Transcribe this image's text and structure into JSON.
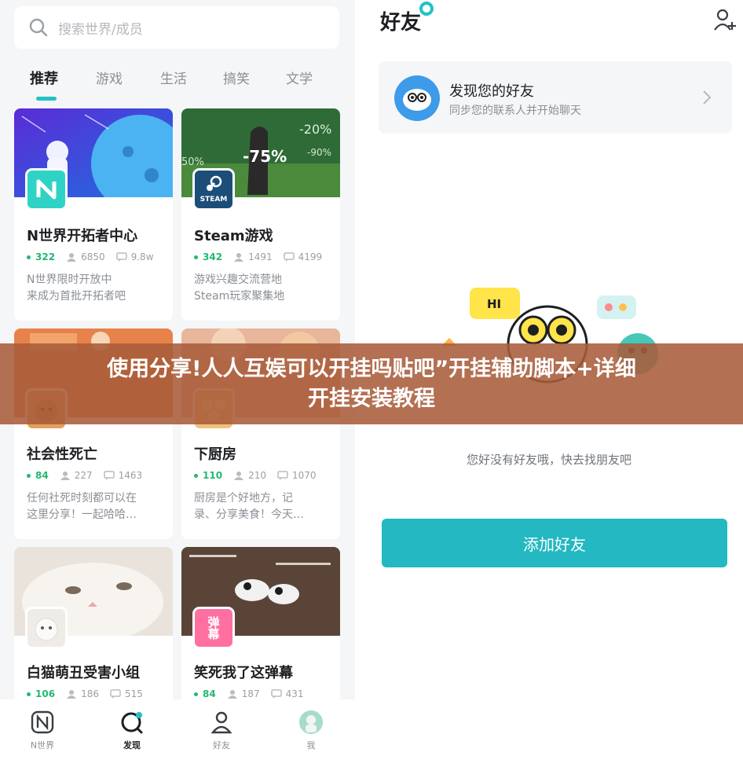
{
  "left": {
    "search": {
      "placeholder": "搜索世界/成员"
    },
    "tabs": [
      {
        "label": "推荐",
        "active": true
      },
      {
        "label": "游戏"
      },
      {
        "label": "生活"
      },
      {
        "label": "搞笑"
      },
      {
        "label": "文学"
      }
    ],
    "cards": [
      {
        "title": "N世界开拓者中心",
        "online": "322",
        "members": "6850",
        "posts": "9.8w",
        "desc": "N世界限时开放中\n来成为首批开拓者吧",
        "avatar": "n-world-logo"
      },
      {
        "title": "Steam游戏",
        "online": "342",
        "members": "1491",
        "posts": "4199",
        "desc": "游戏兴趣交流营地\nSteam玩家聚集地",
        "avatar": "steam-logo",
        "avatar_text": "STEAM"
      },
      {
        "title": "社会性死亡",
        "online": "84",
        "members": "227",
        "posts": "1463",
        "desc": "任何社死时刻都可以在\n这里分享！一起哈哈…"
      },
      {
        "title": "下厨房",
        "online": "110",
        "members": "210",
        "posts": "1070",
        "desc": "厨房是个好地方，记\n录、分享美食！今天…"
      },
      {
        "title": "白猫萌丑受害小组",
        "online": "106",
        "members": "186",
        "posts": "515"
      },
      {
        "title": "笑死我了这弹幕",
        "online": "84",
        "members": "187",
        "posts": "431",
        "avatar_text": "弹幕"
      }
    ],
    "nav": [
      {
        "label": "N世界",
        "icon": "n-world-icon"
      },
      {
        "label": "发现",
        "icon": "discover-icon",
        "active": true
      },
      {
        "label": "好友",
        "icon": "friends-icon"
      },
      {
        "label": "我",
        "icon": "me-avatar-icon"
      }
    ]
  },
  "right": {
    "title": "好友",
    "discover": {
      "title": "发现您的好友",
      "subtitle": "同步您的联系人并开始聊天"
    },
    "bubble_hi": "HI",
    "empty_text": "您好没有好友哦，快去找朋友吧",
    "add_button": "添加好友"
  },
  "banner": {
    "line1": "使用分享!人人互娱可以开挂吗贴吧”开挂辅助脚本+详细",
    "line2": "开挂安装教程"
  },
  "colors": {
    "accent": "#22c2c2",
    "button": "#23b8c2",
    "online": "#22b870",
    "banner": "#a85c3a"
  }
}
